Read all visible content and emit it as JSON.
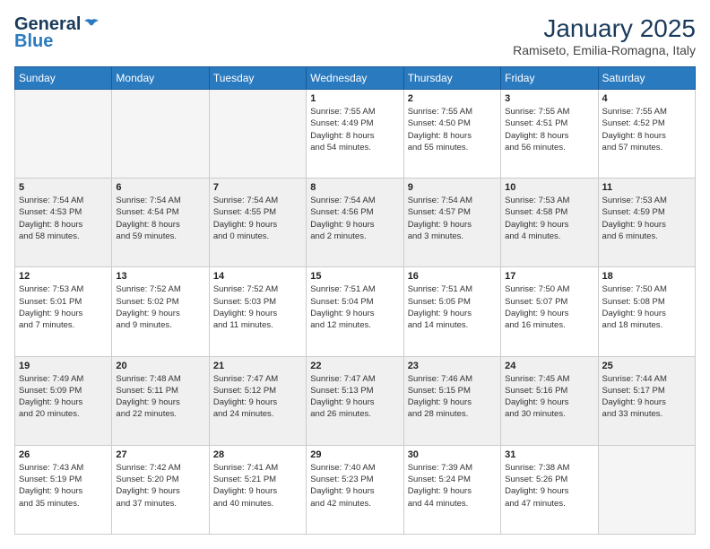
{
  "logo": {
    "general": "General",
    "blue": "Blue"
  },
  "title": "January 2025",
  "subtitle": "Ramiseto, Emilia-Romagna, Italy",
  "days_header": [
    "Sunday",
    "Monday",
    "Tuesday",
    "Wednesday",
    "Thursday",
    "Friday",
    "Saturday"
  ],
  "weeks": [
    [
      {
        "day": "",
        "info": ""
      },
      {
        "day": "",
        "info": ""
      },
      {
        "day": "",
        "info": ""
      },
      {
        "day": "1",
        "info": "Sunrise: 7:55 AM\nSunset: 4:49 PM\nDaylight: 8 hours\nand 54 minutes."
      },
      {
        "day": "2",
        "info": "Sunrise: 7:55 AM\nSunset: 4:50 PM\nDaylight: 8 hours\nand 55 minutes."
      },
      {
        "day": "3",
        "info": "Sunrise: 7:55 AM\nSunset: 4:51 PM\nDaylight: 8 hours\nand 56 minutes."
      },
      {
        "day": "4",
        "info": "Sunrise: 7:55 AM\nSunset: 4:52 PM\nDaylight: 8 hours\nand 57 minutes."
      }
    ],
    [
      {
        "day": "5",
        "info": "Sunrise: 7:54 AM\nSunset: 4:53 PM\nDaylight: 8 hours\nand 58 minutes."
      },
      {
        "day": "6",
        "info": "Sunrise: 7:54 AM\nSunset: 4:54 PM\nDaylight: 8 hours\nand 59 minutes."
      },
      {
        "day": "7",
        "info": "Sunrise: 7:54 AM\nSunset: 4:55 PM\nDaylight: 9 hours\nand 0 minutes."
      },
      {
        "day": "8",
        "info": "Sunrise: 7:54 AM\nSunset: 4:56 PM\nDaylight: 9 hours\nand 2 minutes."
      },
      {
        "day": "9",
        "info": "Sunrise: 7:54 AM\nSunset: 4:57 PM\nDaylight: 9 hours\nand 3 minutes."
      },
      {
        "day": "10",
        "info": "Sunrise: 7:53 AM\nSunset: 4:58 PM\nDaylight: 9 hours\nand 4 minutes."
      },
      {
        "day": "11",
        "info": "Sunrise: 7:53 AM\nSunset: 4:59 PM\nDaylight: 9 hours\nand 6 minutes."
      }
    ],
    [
      {
        "day": "12",
        "info": "Sunrise: 7:53 AM\nSunset: 5:01 PM\nDaylight: 9 hours\nand 7 minutes."
      },
      {
        "day": "13",
        "info": "Sunrise: 7:52 AM\nSunset: 5:02 PM\nDaylight: 9 hours\nand 9 minutes."
      },
      {
        "day": "14",
        "info": "Sunrise: 7:52 AM\nSunset: 5:03 PM\nDaylight: 9 hours\nand 11 minutes."
      },
      {
        "day": "15",
        "info": "Sunrise: 7:51 AM\nSunset: 5:04 PM\nDaylight: 9 hours\nand 12 minutes."
      },
      {
        "day": "16",
        "info": "Sunrise: 7:51 AM\nSunset: 5:05 PM\nDaylight: 9 hours\nand 14 minutes."
      },
      {
        "day": "17",
        "info": "Sunrise: 7:50 AM\nSunset: 5:07 PM\nDaylight: 9 hours\nand 16 minutes."
      },
      {
        "day": "18",
        "info": "Sunrise: 7:50 AM\nSunset: 5:08 PM\nDaylight: 9 hours\nand 18 minutes."
      }
    ],
    [
      {
        "day": "19",
        "info": "Sunrise: 7:49 AM\nSunset: 5:09 PM\nDaylight: 9 hours\nand 20 minutes."
      },
      {
        "day": "20",
        "info": "Sunrise: 7:48 AM\nSunset: 5:11 PM\nDaylight: 9 hours\nand 22 minutes."
      },
      {
        "day": "21",
        "info": "Sunrise: 7:47 AM\nSunset: 5:12 PM\nDaylight: 9 hours\nand 24 minutes."
      },
      {
        "day": "22",
        "info": "Sunrise: 7:47 AM\nSunset: 5:13 PM\nDaylight: 9 hours\nand 26 minutes."
      },
      {
        "day": "23",
        "info": "Sunrise: 7:46 AM\nSunset: 5:15 PM\nDaylight: 9 hours\nand 28 minutes."
      },
      {
        "day": "24",
        "info": "Sunrise: 7:45 AM\nSunset: 5:16 PM\nDaylight: 9 hours\nand 30 minutes."
      },
      {
        "day": "25",
        "info": "Sunrise: 7:44 AM\nSunset: 5:17 PM\nDaylight: 9 hours\nand 33 minutes."
      }
    ],
    [
      {
        "day": "26",
        "info": "Sunrise: 7:43 AM\nSunset: 5:19 PM\nDaylight: 9 hours\nand 35 minutes."
      },
      {
        "day": "27",
        "info": "Sunrise: 7:42 AM\nSunset: 5:20 PM\nDaylight: 9 hours\nand 37 minutes."
      },
      {
        "day": "28",
        "info": "Sunrise: 7:41 AM\nSunset: 5:21 PM\nDaylight: 9 hours\nand 40 minutes."
      },
      {
        "day": "29",
        "info": "Sunrise: 7:40 AM\nSunset: 5:23 PM\nDaylight: 9 hours\nand 42 minutes."
      },
      {
        "day": "30",
        "info": "Sunrise: 7:39 AM\nSunset: 5:24 PM\nDaylight: 9 hours\nand 44 minutes."
      },
      {
        "day": "31",
        "info": "Sunrise: 7:38 AM\nSunset: 5:26 PM\nDaylight: 9 hours\nand 47 minutes."
      },
      {
        "day": "",
        "info": ""
      }
    ]
  ]
}
